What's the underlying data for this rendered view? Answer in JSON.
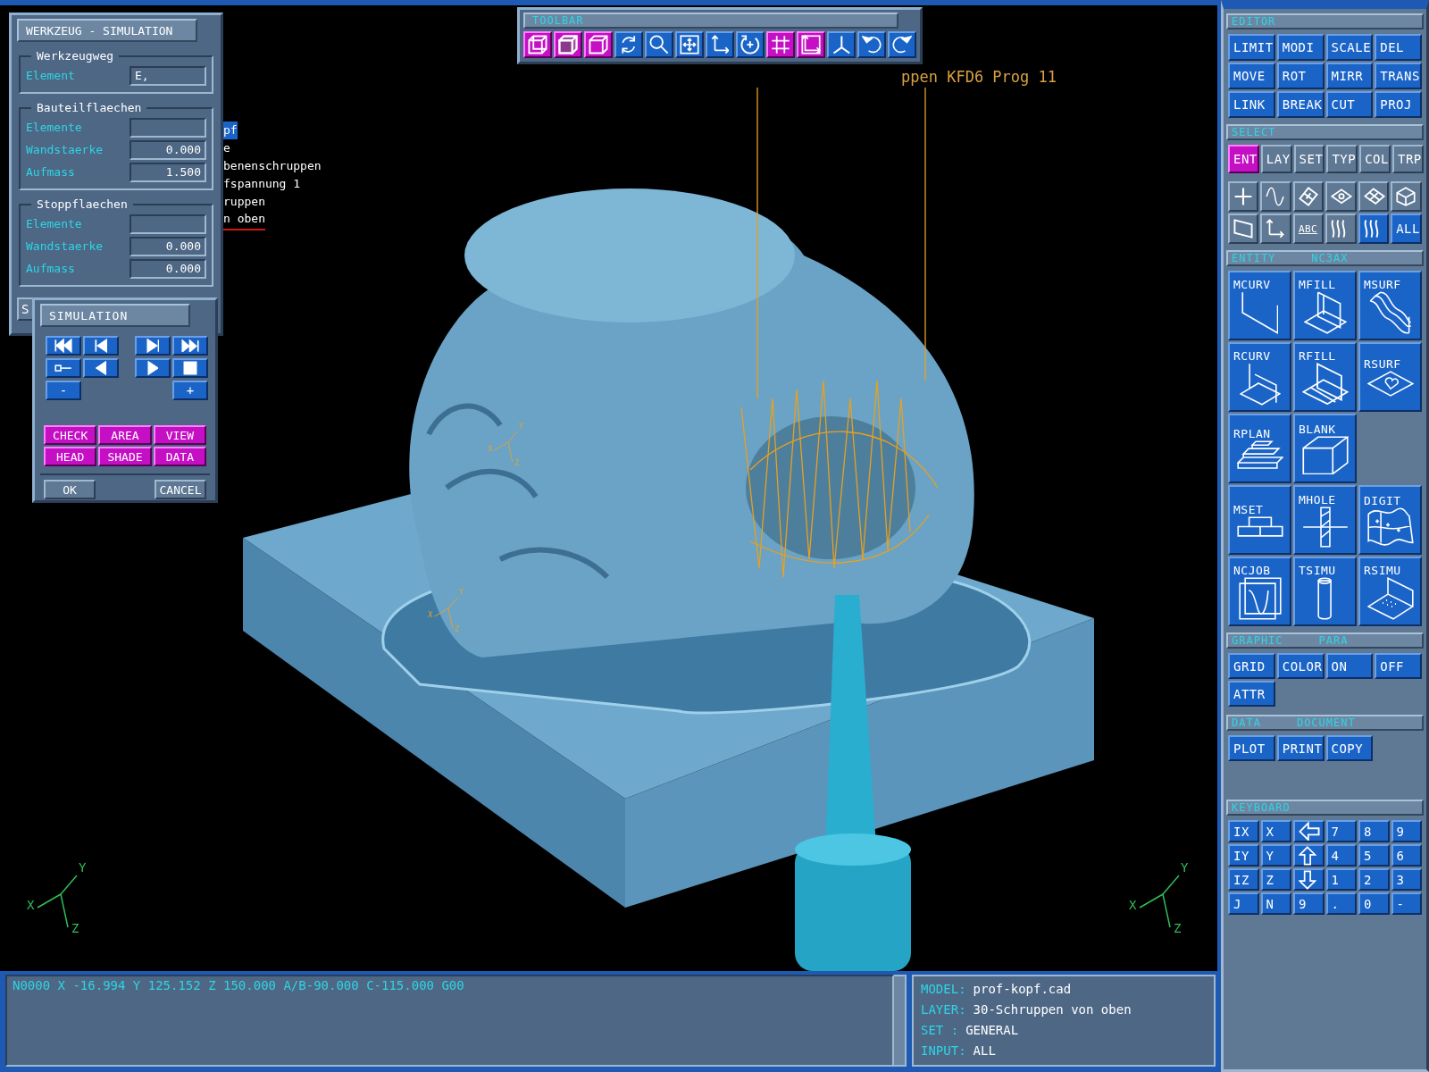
{
  "tool_dialog": {
    "title": "WERKZEUG - SIMULATION",
    "groups": [
      {
        "title": "Werkzeugweg",
        "fields": [
          {
            "label": "Element",
            "value": "E,",
            "kind": "text"
          }
        ]
      },
      {
        "title": "Bauteilflaechen",
        "fields": [
          {
            "label": "Elemente",
            "kind": "text"
          },
          {
            "label": "Wandstaerke",
            "value": "0.000",
            "kind": "number"
          },
          {
            "label": "Aufmass",
            "value": "1.500",
            "kind": "number"
          }
        ]
      },
      {
        "title": "Stoppflaechen",
        "fields": [
          {
            "label": "Elemente",
            "kind": "text"
          },
          {
            "label": "Wandstaerke",
            "value": "0.000",
            "kind": "number"
          },
          {
            "label": "Aufmass",
            "value": "0.000",
            "kind": "number"
          }
        ]
      }
    ],
    "partial_button": "S"
  },
  "simulation": {
    "title": "SIMULATION",
    "controls": [
      {
        "kind": "first"
      },
      {
        "kind": "prev"
      },
      {
        "kind": "next"
      },
      {
        "kind": "last"
      },
      {
        "kind": "slider"
      },
      {
        "kind": "back"
      },
      {
        "kind": "play"
      },
      {
        "kind": "stop"
      },
      {
        "kind": "text",
        "label": "-"
      },
      {
        "kind": "spacer"
      },
      {
        "kind": "spacer"
      },
      {
        "kind": "text",
        "label": "+"
      }
    ],
    "modes": [
      "CHECK",
      "AREA",
      "VIEW",
      "HEAD",
      "SHADE",
      "DATA"
    ],
    "buttons": [
      "OK",
      "CANCEL"
    ]
  },
  "toolbar": {
    "title": "TOOLBAR",
    "tools": [
      {
        "kind": "wire-cube",
        "selected": true
      },
      {
        "kind": "shaded-cube",
        "selected": true
      },
      {
        "kind": "solid-cube",
        "selected": true
      },
      {
        "kind": "rotate",
        "selected": false
      },
      {
        "kind": "zoom",
        "selected": false
      },
      {
        "kind": "pan",
        "selected": false
      },
      {
        "kind": "axes",
        "selected": false
      },
      {
        "kind": "orbit",
        "selected": false
      },
      {
        "kind": "grid",
        "selected": true
      },
      {
        "kind": "frame",
        "selected": true
      },
      {
        "kind": "xyz",
        "selected": false
      },
      {
        "kind": "undo",
        "selected": false
      },
      {
        "kind": "redo",
        "selected": false
      }
    ]
  },
  "viewport": {
    "tree": [
      {
        "text": "pf",
        "selected": true,
        "underlined": false
      },
      {
        "text": "e",
        "selected": false,
        "underlined": false
      },
      {
        "text": "benenschruppen",
        "selected": false,
        "underlined": false
      },
      {
        "text": "fspannung 1",
        "selected": false,
        "underlined": false
      },
      {
        "text": "ruppen",
        "selected": false,
        "underlined": false
      },
      {
        "text": "n oben",
        "selected": false,
        "underlined": true
      }
    ],
    "tool_label": "ppen KFD6 Prog 11",
    "triads": [
      {
        "labels": [
          "X",
          "Y",
          "Z"
        ]
      },
      {
        "labels": [
          "X",
          "Y",
          "Z"
        ]
      },
      {
        "labels": [
          "X",
          "Y",
          "Z"
        ]
      },
      {
        "labels": [
          "X",
          "Y",
          "Z"
        ]
      }
    ]
  },
  "side_panel": {
    "sections": [
      {
        "kind": "editor",
        "titles": [
          "EDITOR"
        ],
        "items": [
          {
            "label": "LIMIT"
          },
          {
            "label": "MODI"
          },
          {
            "label": "SCALE"
          },
          {
            "label": "DEL"
          },
          {
            "label": "MOVE"
          },
          {
            "label": "ROT"
          },
          {
            "label": "MIRR"
          },
          {
            "label": "TRANS"
          },
          {
            "label": "LINK"
          },
          {
            "label": "BREAK"
          },
          {
            "label": "CUT"
          },
          {
            "label": "PROJ"
          }
        ]
      },
      {
        "kind": "select",
        "titles": [
          "SELECT"
        ],
        "items": [
          {
            "label": "ENT",
            "selected": true
          },
          {
            "label": "LAY",
            "selected": false
          },
          {
            "label": "SET",
            "selected": false
          },
          {
            "label": "TYP",
            "selected": false
          },
          {
            "label": "COL",
            "selected": false
          },
          {
            "label": "TRP",
            "selected": false
          }
        ]
      },
      {
        "kind": "filter",
        "items": [
          {
            "kind": "point",
            "selected": false
          },
          {
            "kind": "curve",
            "selected": false
          },
          {
            "kind": "patch",
            "selected": false
          },
          {
            "kind": "hole-plate",
            "selected": false
          },
          {
            "kind": "split-plate",
            "selected": false
          },
          {
            "kind": "solid",
            "selected": false
          },
          {
            "kind": "plane",
            "selected": false
          },
          {
            "kind": "axes",
            "selected": false
          },
          {
            "kind": "small-label",
            "label": "ABC",
            "selected": false
          },
          {
            "kind": "waves",
            "selected": false
          },
          {
            "kind": "waves",
            "selected": true
          },
          {
            "kind": "label",
            "label": "ALL",
            "selected": true
          }
        ]
      },
      {
        "kind": "entity",
        "titles": [
          "ENTITY",
          "NC3AX"
        ],
        "items": [
          {
            "label": "MCURV",
            "kind": "corner"
          },
          {
            "label": "MFILL",
            "kind": "fill"
          },
          {
            "label": "MSURF",
            "kind": "wave-surface"
          },
          {
            "label": "RCURV",
            "kind": "corner2"
          },
          {
            "label": "RFILL",
            "kind": "fill2"
          },
          {
            "label": "RSURF",
            "kind": "plate"
          },
          {
            "label": "RPLAN",
            "kind": "stack"
          },
          {
            "label": "BLANK",
            "kind": "box"
          },
          {
            "kind": "spacer"
          },
          {
            "label": "MSET",
            "kind": "bricks"
          },
          {
            "label": "MHOLE",
            "kind": "drill"
          },
          {
            "label": "DIGIT",
            "kind": "digit"
          },
          {
            "label": "NCJOB",
            "kind": "pages"
          },
          {
            "label": "TSIMU",
            "kind": "cylinder"
          },
          {
            "label": "RSIMU",
            "kind": "dotted"
          }
        ]
      },
      {
        "kind": "graphic",
        "titles": [
          "GRAPHIC",
          "PARA"
        ],
        "items": [
          {
            "label": "GRID"
          },
          {
            "label": "COLOR"
          },
          {
            "label": "ON"
          },
          {
            "label": "OFF"
          },
          {
            "label": "ATTR"
          }
        ]
      },
      {
        "kind": "data",
        "titles": [
          "DATA",
          "DOCUMENT"
        ],
        "items": [
          {
            "label": "PLOT"
          },
          {
            "label": "PRINT"
          },
          {
            "label": "COPY"
          }
        ]
      },
      {
        "kind": "keyboard",
        "titles": [
          "KEYBOARD"
        ],
        "items": [
          {
            "label": "IX"
          },
          {
            "label": "X"
          },
          {
            "kind": "arrow-left"
          },
          {
            "label": "7"
          },
          {
            "label": "8"
          },
          {
            "label": "9"
          },
          {
            "label": "IY"
          },
          {
            "label": "Y"
          },
          {
            "kind": "arrow-up"
          },
          {
            "label": "4"
          },
          {
            "label": "5"
          },
          {
            "label": "6"
          },
          {
            "label": "IZ"
          },
          {
            "label": "Z"
          },
          {
            "kind": "arrow-down"
          },
          {
            "label": "1"
          },
          {
            "label": "2"
          },
          {
            "label": "3"
          },
          {
            "label": "J"
          },
          {
            "label": "N"
          },
          {
            "label": "9"
          },
          {
            "label": "."
          },
          {
            "label": "0"
          },
          {
            "label": "-"
          }
        ]
      }
    ]
  },
  "status": {
    "command_line": "N0000 X -16.994 Y 125.152 Z 150.000 A/B-90.000 C-115.000 G00",
    "info": [
      {
        "label": "MODEL:",
        "value": "prof-kopf.cad"
      },
      {
        "label": "LAYER:",
        "value": "30-Schruppen von oben"
      },
      {
        "label": "SET  :",
        "value": "GENERAL"
      },
      {
        "label": "INPUT:",
        "value": "ALL"
      }
    ]
  }
}
